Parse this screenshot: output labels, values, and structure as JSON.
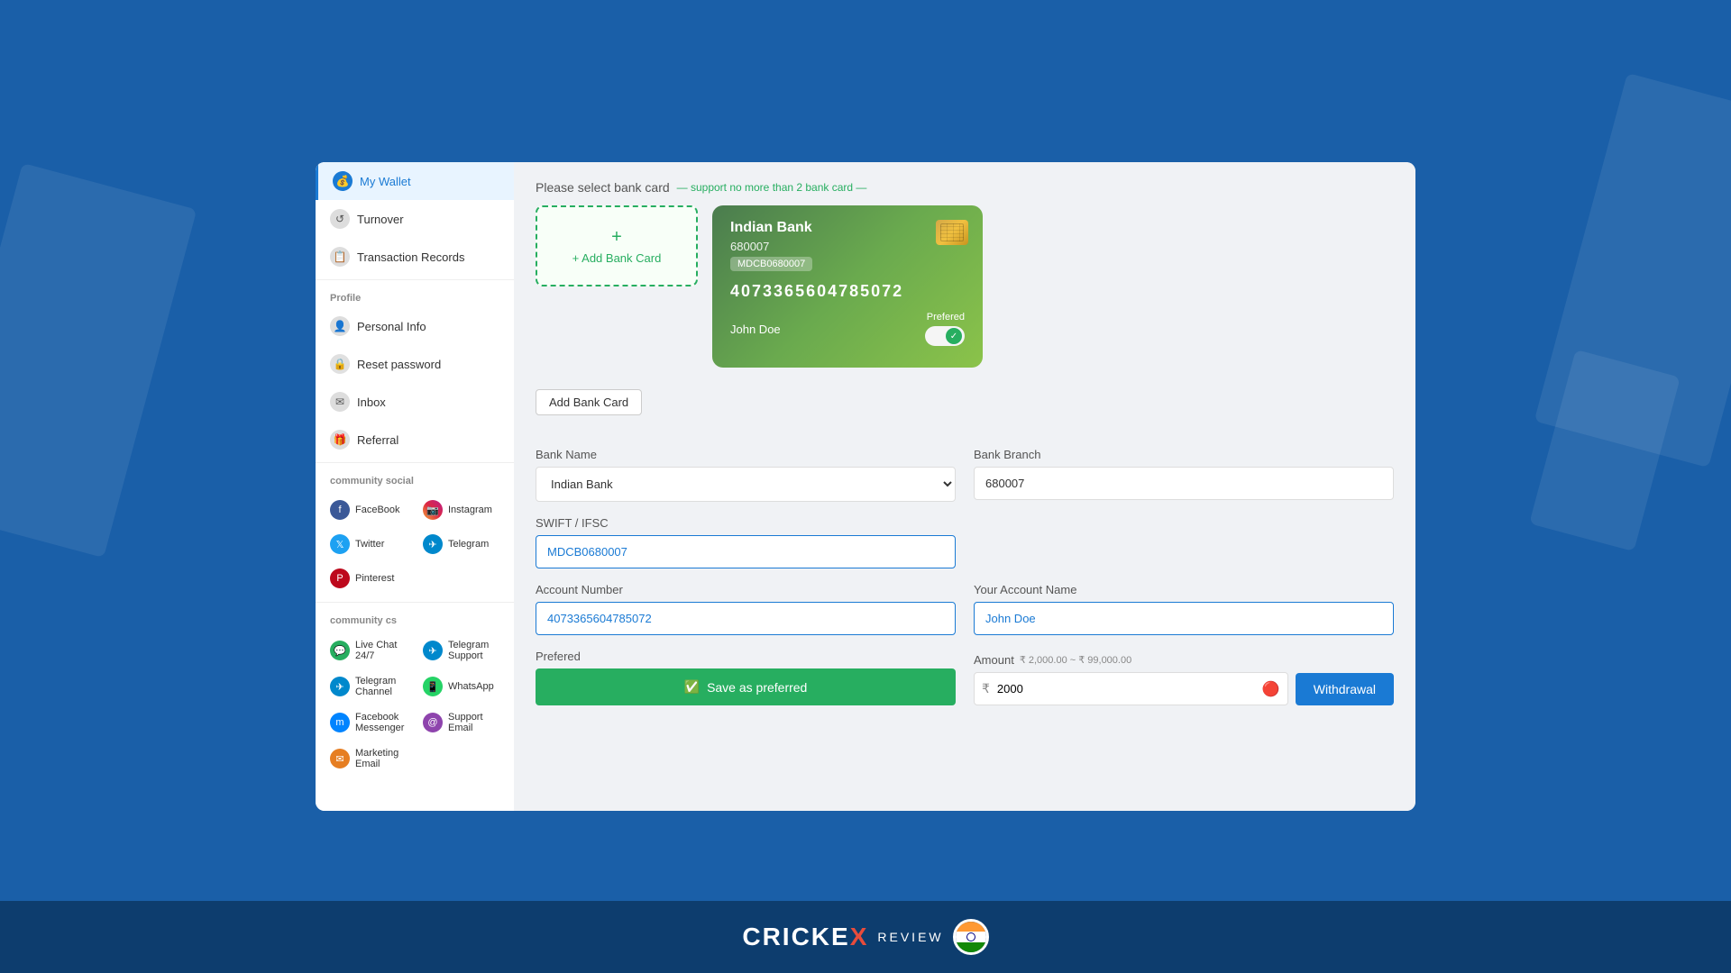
{
  "sidebar": {
    "wallet": {
      "label": "My Wallet",
      "active": true
    },
    "turnover": {
      "label": "Turnover"
    },
    "transaction": {
      "label": "Transaction Records"
    },
    "profile_section": "Profile",
    "personal_info": {
      "label": "Personal Info"
    },
    "reset_password": {
      "label": "Reset password"
    },
    "inbox": {
      "label": "Inbox"
    },
    "referral": {
      "label": "Referral"
    },
    "community_social_title": "community social",
    "community_cs_title": "community cs",
    "social_items": [
      {
        "label": "FaceBook",
        "icon": "F"
      },
      {
        "label": "Instagram",
        "icon": "I"
      },
      {
        "label": "Twitter",
        "icon": "T"
      },
      {
        "label": "Telegram",
        "icon": "T"
      },
      {
        "label": "Pinterest",
        "icon": "P"
      }
    ],
    "cs_items": [
      {
        "label": "Live Chat 24/7",
        "icon": "C"
      },
      {
        "label": "Telegram Support",
        "icon": "T"
      },
      {
        "label": "Telegram Channel",
        "icon": "T"
      },
      {
        "label": "WhatsApp",
        "icon": "W"
      },
      {
        "label": "Facebook Messenger",
        "icon": "M"
      },
      {
        "label": "Support Email",
        "icon": "S"
      },
      {
        "label": "Marketing Email",
        "icon": "E"
      }
    ]
  },
  "main": {
    "select_bank_title": "Please select bank card",
    "support_note": "— support no more than 2 bank card —",
    "add_bank_label": "+ Add Bank Card",
    "add_bank_below_label": "Add Bank Card",
    "bank_card": {
      "bank_name": "Indian Bank",
      "account_id": "680007",
      "badge": "MDCB0680007",
      "card_number": "4073365604785072",
      "holder": "John Doe",
      "preferred_label": "Prefered",
      "toggle_on": true,
      "check_mark": "✓"
    },
    "form": {
      "bank_name_label": "Bank Name",
      "bank_name_value": "Indian Bank",
      "bank_branch_label": "Bank Branch",
      "bank_branch_value": "680007",
      "swift_label": "SWIFT / IFSC",
      "swift_value": "MDCB0680007",
      "account_number_label": "Account Number",
      "account_number_value": "4073365604785072",
      "account_name_label": "Your Account Name",
      "account_name_value": "John Doe",
      "preferred_label": "Prefered",
      "save_preferred_label": "Save as preferred",
      "amount_label": "Amount",
      "amount_range": "₹ 2,000.00 ~ ₹ 99,000.00",
      "currency_symbol": "₹",
      "amount_value": "2000",
      "withdrawal_label": "Withdrawal"
    }
  },
  "footer": {
    "logo_text": "CRICKE",
    "logo_x": "X",
    "sub_label": "REVIEW"
  }
}
